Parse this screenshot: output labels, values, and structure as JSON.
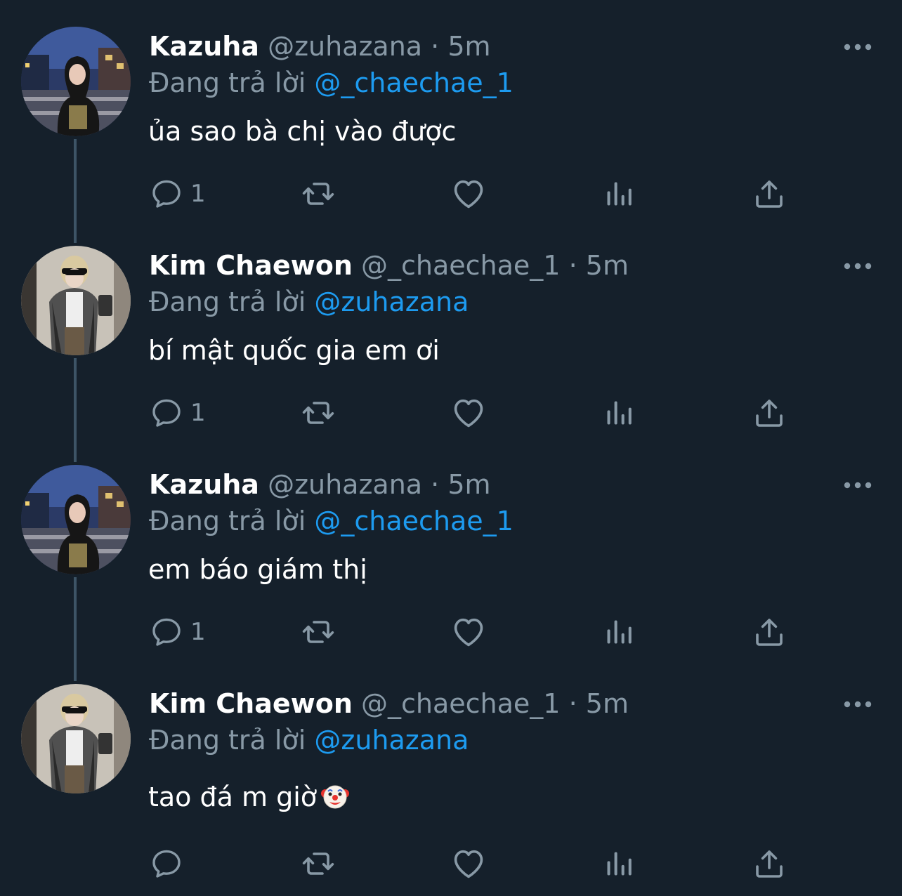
{
  "tweets": [
    {
      "name": "Kazuha",
      "handle": "@zuhazana",
      "separator": "·",
      "time": "5m",
      "reply_prefix": "Đang trả lời",
      "reply_to": "@_chaechae_1",
      "text": "ủa sao bà chị vào được",
      "emoji": "",
      "reply_count": "1",
      "avatar": "kazuha-avatar"
    },
    {
      "name": "Kim Chaewon",
      "handle": "@_chaechae_1",
      "separator": "·",
      "time": "5m",
      "reply_prefix": "Đang trả lời",
      "reply_to": "@zuhazana",
      "text": "bí mật quốc gia em ơi",
      "emoji": "",
      "reply_count": "1",
      "avatar": "chaewon-avatar"
    },
    {
      "name": "Kazuha",
      "handle": "@zuhazana",
      "separator": "·",
      "time": "5m",
      "reply_prefix": "Đang trả lời",
      "reply_to": "@_chaechae_1",
      "text": "em báo giám thị",
      "emoji": "",
      "reply_count": "1",
      "avatar": "kazuha-avatar"
    },
    {
      "name": "Kim Chaewon",
      "handle": "@_chaechae_1",
      "separator": "·",
      "time": "5m",
      "reply_prefix": "Đang trả lời",
      "reply_to": "@zuhazana",
      "text": "tao đá m giờ",
      "emoji": "clown-face-emoji",
      "reply_count": "",
      "avatar": "chaewon-avatar"
    }
  ],
  "icons": {
    "reply": "reply-icon",
    "retweet": "retweet-icon",
    "like": "heart-icon",
    "views": "views-icon",
    "share": "share-icon",
    "more": "more-icon"
  },
  "colors": {
    "background": "#15202b",
    "primary_text": "#ffffff",
    "secondary_text": "#8899a6",
    "link": "#1d9bf0",
    "thread_line": "#3d5466"
  }
}
